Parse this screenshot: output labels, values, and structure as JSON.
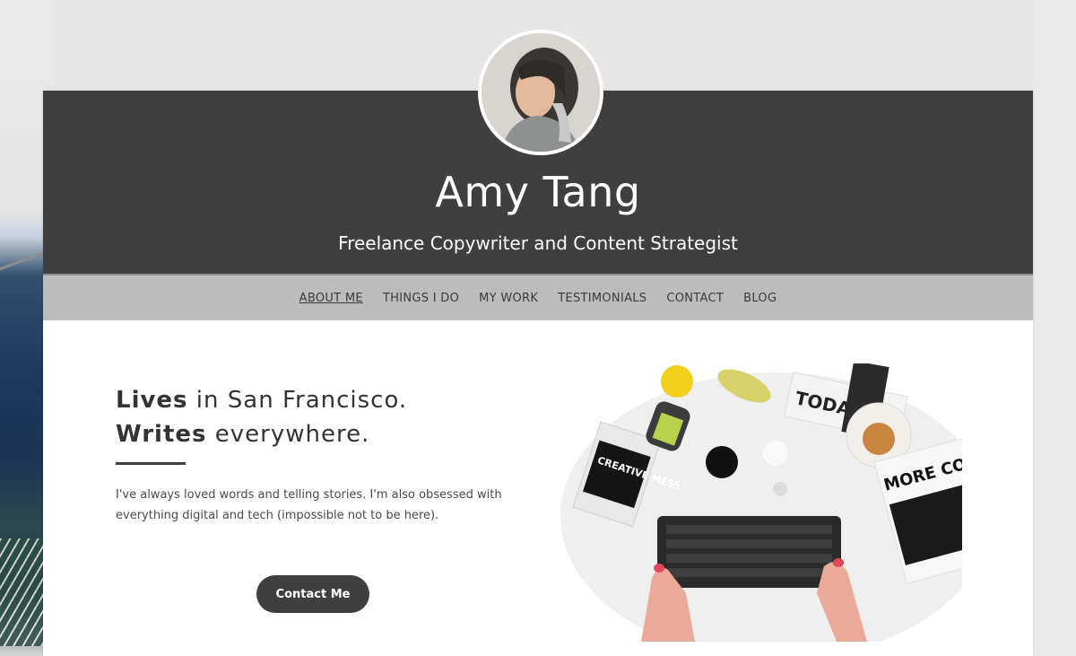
{
  "site": {
    "title": "Amy Tang",
    "subtitle": "Freelance Copywriter and Content Strategist"
  },
  "nav": {
    "items": [
      {
        "label": "ABOUT ME",
        "active": true
      },
      {
        "label": "THINGS I DO",
        "active": false
      },
      {
        "label": "MY WORK",
        "active": false
      },
      {
        "label": "TESTIMONIALS",
        "active": false
      },
      {
        "label": "CONTACT",
        "active": false
      },
      {
        "label": "BLOG",
        "active": false
      }
    ]
  },
  "intro": {
    "line1_bold": "Lives",
    "line1_rest": " in San Francisco.",
    "line2_bold": "Writes",
    "line2_rest": " everywhere.",
    "bio": "I've always loved words and telling stories. I'm also obsessed with everything digital and tech (impossible not to be here).",
    "cta_label": "Contact Me"
  },
  "hero_image": {
    "sticker_text": "CREATIVE MESS",
    "poster_text": "MORE CONTENT THAN",
    "corner_text": "TODAY"
  },
  "colors": {
    "band": "#3f3f3f",
    "nav_bg": "#bcbcbc",
    "text": "#333333"
  }
}
